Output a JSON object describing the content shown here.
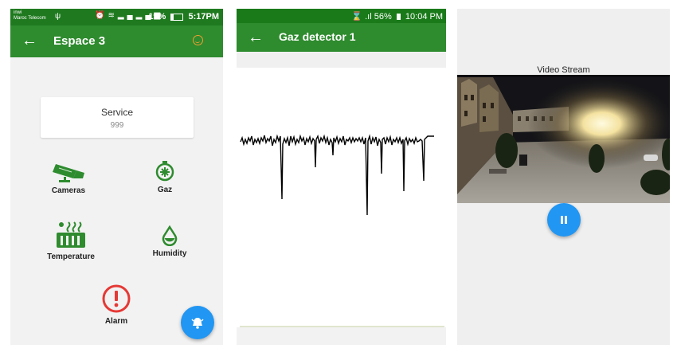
{
  "screen1": {
    "statusbar": {
      "carrier_line1": "inwi",
      "carrier_line2": "Maroc Telecom",
      "battery": "19%",
      "time": "5:17PM"
    },
    "appbar": {
      "title": "Espace 3"
    },
    "service": {
      "title": "Service",
      "value": "999"
    },
    "tiles": [
      {
        "label": "Cameras",
        "icon": "cctv-camera-icon"
      },
      {
        "label": "Gaz",
        "icon": "gas-timer-icon"
      },
      {
        "label": "Temperature",
        "icon": "radiator-icon"
      },
      {
        "label": "Humidity",
        "icon": "water-drop-icon"
      },
      {
        "label": "Alarm",
        "icon": "alert-circle-icon"
      }
    ],
    "fab_icon": "alarm-bell-icon"
  },
  "screen2": {
    "statusbar": {
      "battery": "56%",
      "time": "10:04 PM"
    },
    "appbar": {
      "title": "Gaz detector 1"
    }
  },
  "screen3": {
    "video_title": "Video Stream",
    "fab_icon": "pause-icon"
  },
  "colors": {
    "appbar": "#2e8b2e",
    "statusbar": "#1f7a1f",
    "fab": "#2196f3",
    "icon_green": "#2e8b2e",
    "alarm_red": "#e53935"
  }
}
